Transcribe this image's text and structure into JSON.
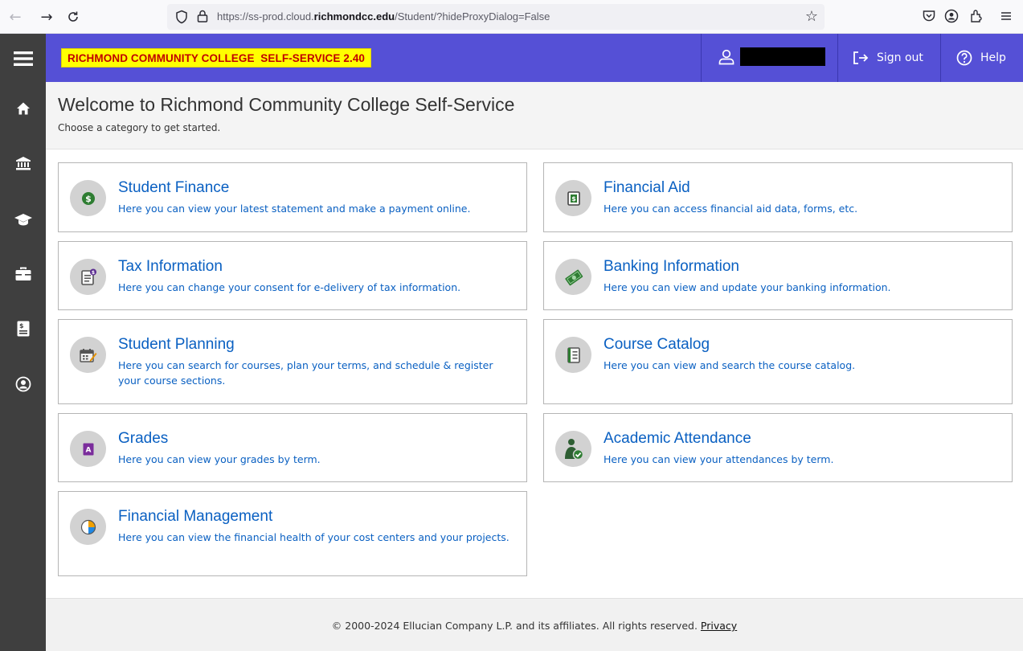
{
  "browser": {
    "url_prefix": "https://ss-prod.cloud.",
    "url_domain": "richmondcc.edu",
    "url_path": "/Student/?hideProxyDialog=False"
  },
  "header": {
    "logo_text": "RICHMOND COMMUNITY COLLEGE  SELF-SERVICE 2.40",
    "sign_out_label": "Sign out",
    "help_label": "Help",
    "colors": {
      "header_bg": "#5550d6",
      "logo_bg": "#ffff00",
      "logo_text": "#c00000"
    }
  },
  "welcome": {
    "title": "Welcome to Richmond Community College Self-Service",
    "subtitle": "Choose a category to get started."
  },
  "categories": [
    {
      "title": "Student Finance",
      "description": "Here you can view your latest statement and make a payment online.",
      "icon": "dollar-coin-icon"
    },
    {
      "title": "Financial Aid",
      "description": "Here you can access financial aid data, forms, etc.",
      "icon": "dollar-document-icon"
    },
    {
      "title": "Tax Information",
      "description": "Here you can change your consent for e-delivery of tax information.",
      "icon": "tax-form-icon"
    },
    {
      "title": "Banking Information",
      "description": "Here you can view and update your banking information.",
      "icon": "money-bills-icon"
    },
    {
      "title": "Student Planning",
      "description": "Here you can search for courses, plan your terms, and schedule & register your course sections.",
      "icon": "calendar-pencil-icon"
    },
    {
      "title": "Course Catalog",
      "description": "Here you can view and search the course catalog.",
      "icon": "catalog-book-icon"
    },
    {
      "title": "Grades",
      "description": "Here you can view your grades by term.",
      "icon": "grade-report-icon"
    },
    {
      "title": "Academic Attendance",
      "description": "Here you can view your attendances by term.",
      "icon": "attendance-person-check-icon"
    },
    {
      "title": "Financial Management",
      "description": "Here you can view the financial health of your cost centers and your projects.",
      "icon": "pie-chart-icon"
    }
  ],
  "footer": {
    "copyright": "© 2000-2024 Ellucian Company L.P. and its affiliates. All rights reserved.",
    "privacy_label": "Privacy"
  },
  "colors": {
    "link": "#0a60c2",
    "leftnav_bg": "#3f3f3f"
  }
}
